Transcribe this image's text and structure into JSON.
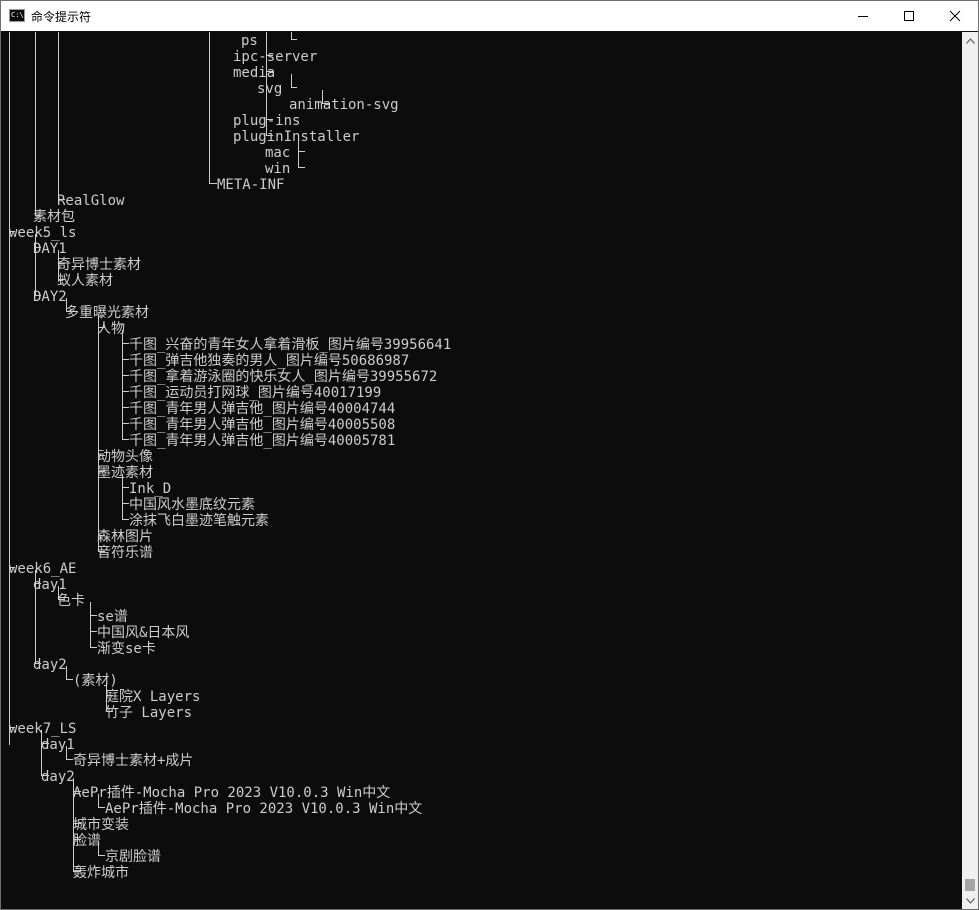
{
  "window": {
    "title": "命令提示符",
    "app_icon_text": "C:\\.",
    "controls": [
      "minimize-icon",
      "maximize-icon",
      "close-icon"
    ]
  },
  "terminal": {
    "background": "#0c0c0c",
    "foreground": "#cccccc",
    "lines": [
      "                              ps",
      "                             ipc-server",
      "                             media",
      "                                svg",
      "                                    animation-svg",
      "                             plug-ins",
      "                             pluginInstaller",
      "                                 mac",
      "                                 win",
      "                           META-INF",
      "       RealGlow",
      "    素材包",
      " week5_ls",
      "    DAY1",
      "       奇异博士素材",
      "       蚁人素材",
      "    DAY2",
      "        多重曝光素材",
      "            人物",
      "                千图_兴奋的青年女人拿着滑板_图片编号39956641",
      "                千图_弹吉他独奏的男人_图片编号50686987",
      "                千图_拿着游泳圈的快乐女人_图片编号39955672",
      "                千图_运动员打网球_图片编号40017199",
      "                千图_青年男人弹吉他_图片编号40004744",
      "                千图_青年男人弹吉他_图片编号40005508",
      "                千图_青年男人弹吉他_图片编号40005781",
      "            动物头像",
      "            墨迹素材",
      "                Ink_D",
      "                中国风水墨底纹元素",
      "                涂抹飞白墨迹笔触元素",
      "            森林图片",
      "            音符乐谱",
      " week6_AE",
      "    day1",
      "       色卡",
      "            se谱",
      "            中国风&日本风",
      "            渐变se卡",
      "    day2",
      "         (素材)",
      "             庭院X Layers",
      "             竹子 Layers",
      " week7_LS",
      "     day1",
      "         奇异博士素材+成片",
      "     day2",
      "         AePr插件-Mocha Pro 2023 V10.0.3 Win中文",
      "             AePr插件-Mocha Pro 2023 V10.0.3 Win中文",
      "         城市变装",
      "         脸谱",
      "             京剧脸谱",
      "         轰炸城市"
    ]
  },
  "scrollbar": {
    "up_icon": "scroll-up-arrow-icon",
    "down_icon": "scroll-down-arrow-icon",
    "position": 1.0
  }
}
